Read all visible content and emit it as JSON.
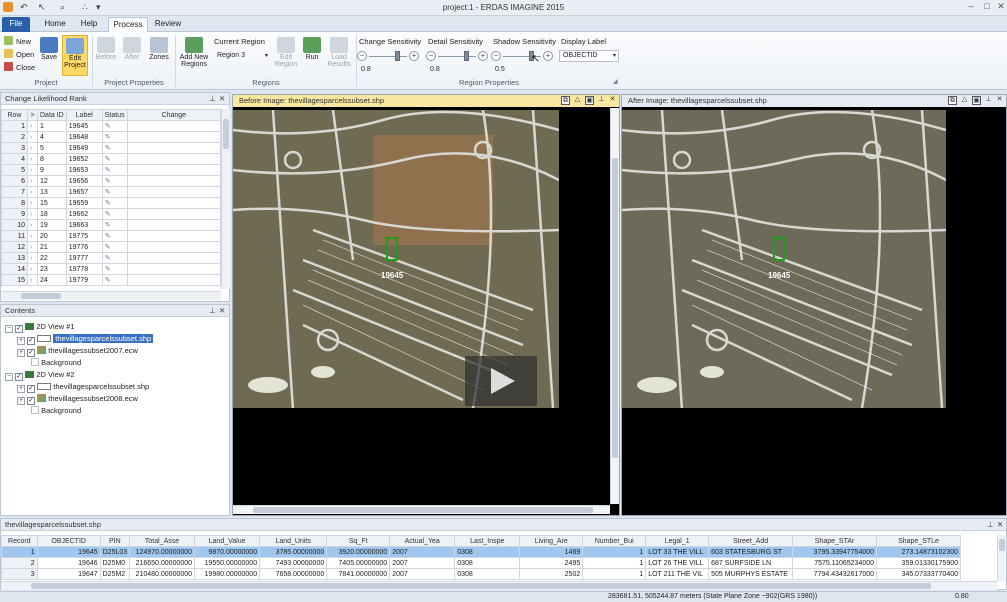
{
  "window": {
    "title": "project:1 - ERDAS IMAGINE 2015"
  },
  "qat": {
    "undo": "↶",
    "pointer": "↖",
    "zoom": "⌕",
    "dots": "∴",
    "more": "▾"
  },
  "tabs": [
    {
      "label": "File"
    },
    {
      "label": "Home"
    },
    {
      "label": "Help"
    },
    {
      "label": "Process"
    },
    {
      "label": "Review"
    }
  ],
  "ribbon": {
    "project": {
      "new": "New",
      "open": "Open",
      "close": "Close",
      "save": "Save",
      "edit_project": "Edit Project",
      "label": "Project"
    },
    "project_properties": {
      "before": "Before",
      "after": "After",
      "zones": "Zones",
      "label": "Project Properties"
    },
    "regions": {
      "add_new_regions": "Add New Regions",
      "current_region_label": "Current Region",
      "current_region_value": "Region 3",
      "edit_region": "Edit Region",
      "run": "Run",
      "load_results": "Load Results",
      "label": "Regions"
    },
    "region_properties": {
      "change_label": "Change Sensitivity",
      "change_value": "0.8",
      "detail_label": "Detail Sensitivity",
      "detail_value": "0.8",
      "shadow_label": "Shadow Sensitivity",
      "shadow_value": "0.5",
      "label": "Region Properties"
    },
    "display_label": {
      "label": "Display Label",
      "value": "OBJECTID"
    }
  },
  "change_panel": {
    "title": "Change Likelihood Rank",
    "columns": [
      "Row",
      ">",
      "Data ID",
      "Label",
      "Status",
      "Change"
    ],
    "rows": [
      [
        "1",
        "1",
        "19645"
      ],
      [
        "2",
        "4",
        "19648"
      ],
      [
        "3",
        "5",
        "19649"
      ],
      [
        "4",
        "8",
        "19652"
      ],
      [
        "5",
        "9",
        "19653"
      ],
      [
        "6",
        "12",
        "19656"
      ],
      [
        "7",
        "13",
        "19657"
      ],
      [
        "8",
        "15",
        "19659"
      ],
      [
        "9",
        "18",
        "19662"
      ],
      [
        "10",
        "19",
        "19663"
      ],
      [
        "11",
        "20",
        "19775"
      ],
      [
        "12",
        "21",
        "19776"
      ],
      [
        "13",
        "22",
        "19777"
      ],
      [
        "14",
        "23",
        "19778"
      ],
      [
        "15",
        "24",
        "19779"
      ]
    ]
  },
  "contents_panel": {
    "title": "Contents",
    "view1": "2D View #1",
    "view1_layer1": "thevillagesparcelssubset.shp",
    "view1_layer2": "thevillagessubset2007.ecw",
    "view1_bg": "Background",
    "view2": "2D View #2",
    "view2_layer1": "thevillagesparcelssubset.shp",
    "view2_layer2": "thevillagessubset2008.ecw",
    "view2_bg": "Background"
  },
  "before_view": {
    "title": "Before Image: thevillagesparcelssubset.shp",
    "parcel_label": "19645"
  },
  "after_view": {
    "title": "After Image: thevillagesparcelssubset.shp",
    "parcel_label": "19645"
  },
  "attr_table": {
    "title": "thevillagesparcelssubset.shp",
    "columns": [
      "Record",
      "OBJECTID",
      "PIN",
      "Total_Asse",
      "Land_Value",
      "Land_Units",
      "Sq_Ft",
      "Actual_Yea",
      "Last_Inspe",
      "Living_Are",
      "Number_Bui",
      "Legal_1",
      "Street_Add",
      "Shape_STAr",
      "Shape_STLe"
    ],
    "rows": [
      [
        "1",
        "19645",
        "D25L03",
        "124970.00000000",
        "9870.00000000",
        "3785.00000000",
        "3920.00000000",
        "2007",
        "0308",
        "1469",
        "1",
        "LOT 33 THE VILL",
        "603 STATESBURG ST",
        "3795.33947754000",
        "273.14873102300"
      ],
      [
        "2",
        "19646",
        "D25M0",
        "216650.00000000",
        "19550.00000000",
        "7493.00000000",
        "7405.00000000",
        "2007",
        "0308",
        "2495",
        "1",
        "LOT 26 THE VILL",
        "687 SURFSIDE LN",
        "7575.11065234000",
        "359.01330175900"
      ],
      [
        "3",
        "19647",
        "D25M2",
        "210480.00000000",
        "19980.00000000",
        "7658.00000000",
        "7841.00000000",
        "2007",
        "0308",
        "2502",
        "1",
        "LOT 211 THE VIL",
        "505 MURPHYS ESTATE",
        "7794.43432617000",
        "345.07333770400"
      ]
    ]
  },
  "status": {
    "coords": "283681.51, 505244.87 meters (State Plane Zone ~902(GRS 1980))",
    "zoom": "0.80"
  },
  "colors": {
    "accent": "#2a5ea8",
    "highlight": "#ffd966",
    "selection": "#9fc7ef",
    "parcel_green": "#1aa01a"
  }
}
